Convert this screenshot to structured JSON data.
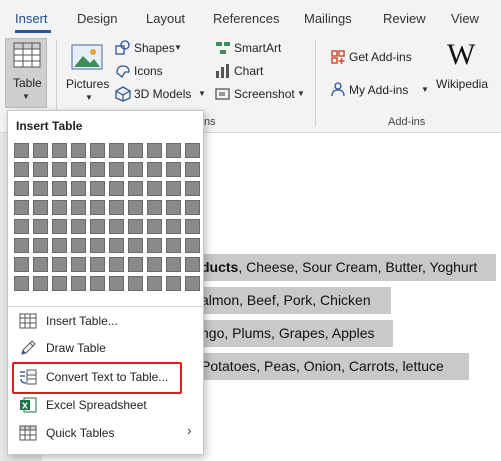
{
  "tabs": [
    "Insert",
    "Design",
    "Layout",
    "References",
    "Mailings",
    "Review",
    "View"
  ],
  "ribbon": {
    "table_label": "Table",
    "pictures_label": "Pictures",
    "shapes_label": "Shapes",
    "icons_label": "Icons",
    "models_label": "3D Models",
    "smartart_label": "SmartArt",
    "chart_label": "Chart",
    "screenshot_label": "Screenshot",
    "get_addins_label": "Get Add-ins",
    "my_addins_label": "My Add-ins",
    "wikipedia_label": "Wikipedia",
    "wikipedia_glyph": "W",
    "group_illustrations_partial": "ns",
    "group_addins": "Add-ins"
  },
  "menu": {
    "title": "Insert Table",
    "grid": {
      "rows": 8,
      "cols": 10
    },
    "items": [
      {
        "label": "Insert Table...",
        "icon": "table-grid-icon"
      },
      {
        "label": "Draw Table",
        "icon": "pencil-icon"
      },
      {
        "label": "Convert Text to Table...",
        "icon": "convert-text-icon",
        "highlighted": true
      },
      {
        "label": "Excel Spreadsheet",
        "icon": "excel-icon"
      },
      {
        "label": "Quick Tables",
        "icon": "quick-tables-icon",
        "has_submenu": true
      }
    ]
  },
  "document": {
    "lines": [
      {
        "bold": "ducts",
        "rest": ", Cheese, Sour Cream, Butter, Yoghurt"
      },
      {
        "bold": "",
        "rest": "almon, Beef, Pork, Chicken"
      },
      {
        "bold": "",
        "rest": "ngo, Plums, Grapes, Apples"
      },
      {
        "bold": "",
        "rest": " Potatoes, Peas, Onion, Carrots, lettuce"
      }
    ]
  },
  "colors": {
    "accent": "#2b579a",
    "selection": "#c9c9c9",
    "highlight_border": "#e01919"
  }
}
